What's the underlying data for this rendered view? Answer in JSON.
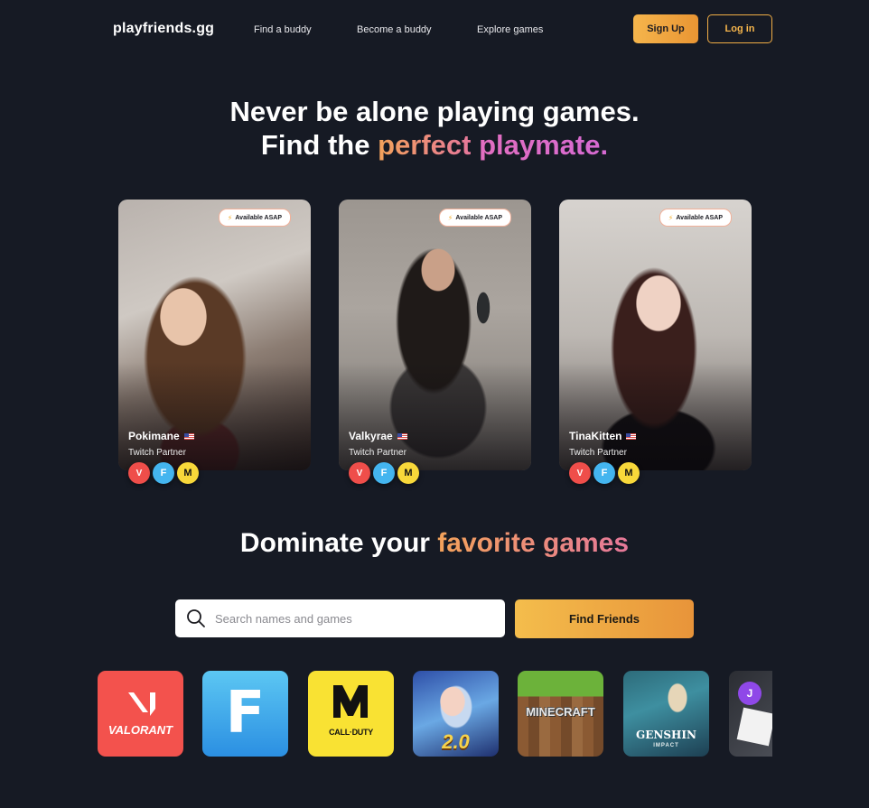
{
  "nav": {
    "logo": "playfriends.gg",
    "links": [
      "Find a buddy",
      "Become a buddy",
      "Explore games"
    ],
    "signup": "Sign Up",
    "login": "Log in"
  },
  "hero": {
    "line1": "Never be alone playing games.",
    "line2_prefix": "Find the",
    "line2_word1": "perfect",
    "line2_word2": "playmate."
  },
  "cards": [
    {
      "name": "Pokimane",
      "subtitle": "Twitch Partner",
      "badge": "Available ASAP",
      "flag": "us-flag",
      "games": [
        "valorant",
        "fortnite",
        "call-of-duty-mobile"
      ]
    },
    {
      "name": "Valkyrae",
      "subtitle": "Twitch Partner",
      "badge": "Available ASAP",
      "flag": "us-flag",
      "games": [
        "valorant",
        "fortnite",
        "call-of-duty-mobile"
      ]
    },
    {
      "name": "TinaKitten",
      "subtitle": "Twitch Partner",
      "badge": "Available ASAP",
      "flag": "us-flag",
      "games": [
        "valorant",
        "fortnite",
        "call-of-duty-mobile"
      ]
    }
  ],
  "section2": {
    "title_prefix": "Dominate your",
    "title_highlight": "favorite games"
  },
  "search": {
    "placeholder": "Search names and games",
    "button": "Find Friends"
  },
  "game_tiles": {
    "valorant": "VALORANT",
    "fortnite": "F",
    "cod_line1": "CALL",
    "cod_line2": "DUTY",
    "mlbb_version": "2.0",
    "minecraft": "MINECRAFT",
    "genshin": "GENSHIN",
    "genshin_sub": "IMPACT",
    "avatar_letter": "J"
  },
  "colors": {
    "background": "#161a24",
    "accent_orange": "#f5b54c",
    "accent_pink": "#e26ec0"
  }
}
